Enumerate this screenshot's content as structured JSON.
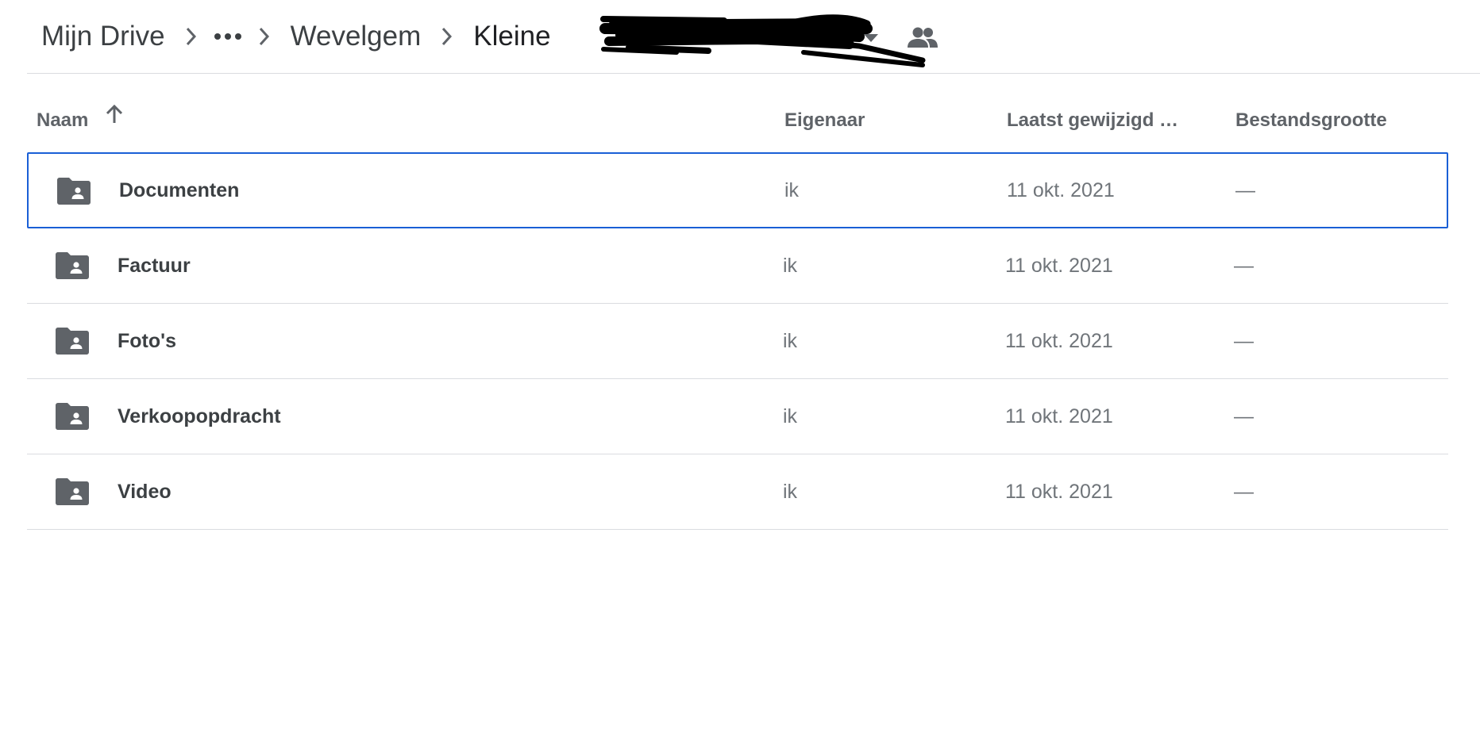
{
  "breadcrumb": {
    "root": "Mijn Drive",
    "overflow_icon": "more-horiz-icon",
    "parent": "Wevelgem",
    "current": "Kleine",
    "separator_icon": "chevron-right-icon",
    "dropdown_icon": "arrow-drop-down-icon",
    "shared_icon": "people-icon"
  },
  "table": {
    "headers": {
      "name": "Naam",
      "owner": "Eigenaar",
      "modified": "Laatst gewijzigd …",
      "size": "Bestandsgrootte"
    },
    "sort_icon": "arrow-upward-icon",
    "rows": [
      {
        "name": "Documenten",
        "owner": "ik",
        "modified": "11 okt. 2021",
        "size": "—",
        "selected": true,
        "icon": "shared-folder-icon"
      },
      {
        "name": "Factuur",
        "owner": "ik",
        "modified": "11 okt. 2021",
        "size": "—",
        "selected": false,
        "icon": "shared-folder-icon"
      },
      {
        "name": "Foto's",
        "owner": "ik",
        "modified": "11 okt. 2021",
        "size": "—",
        "selected": false,
        "icon": "shared-folder-icon"
      },
      {
        "name": "Verkoopopdracht",
        "owner": "ik",
        "modified": "11 okt. 2021",
        "size": "—",
        "selected": false,
        "icon": "shared-folder-icon"
      },
      {
        "name": "Video",
        "owner": "ik",
        "modified": "11 okt. 2021",
        "size": "—",
        "selected": false,
        "icon": "shared-folder-icon"
      }
    ]
  },
  "colors": {
    "selection_border": "#1a5fd6",
    "icon_gray": "#5f6368",
    "divider": "#dadce0"
  }
}
